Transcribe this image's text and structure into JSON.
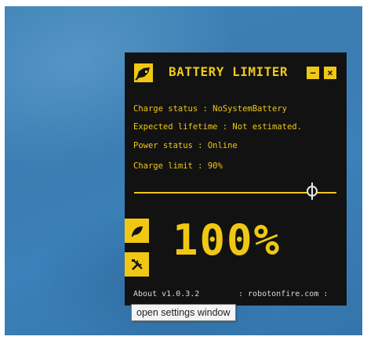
{
  "app": {
    "title": "BATTERY LIMITER",
    "minimize_label": "−",
    "close_label": "×",
    "accent_color": "#f0c814",
    "background_color": "#121212"
  },
  "status": {
    "charge_status": "Charge status : NoSystemBattery",
    "expected_lifetime": "Expected lifetime : Not estimated.",
    "power_status": "Power status : Online",
    "charge_limit": "Charge limit : 90%"
  },
  "slider": {
    "value_percent": 90
  },
  "battery": {
    "charge_display": "100%"
  },
  "side_buttons": [
    {
      "icon": "leaf-icon"
    },
    {
      "icon": "tools-icon"
    }
  ],
  "footer": {
    "about": "About v1.0.3.2",
    "site": ": robotonfire.com :"
  },
  "tooltip": {
    "text": "open settings window"
  }
}
